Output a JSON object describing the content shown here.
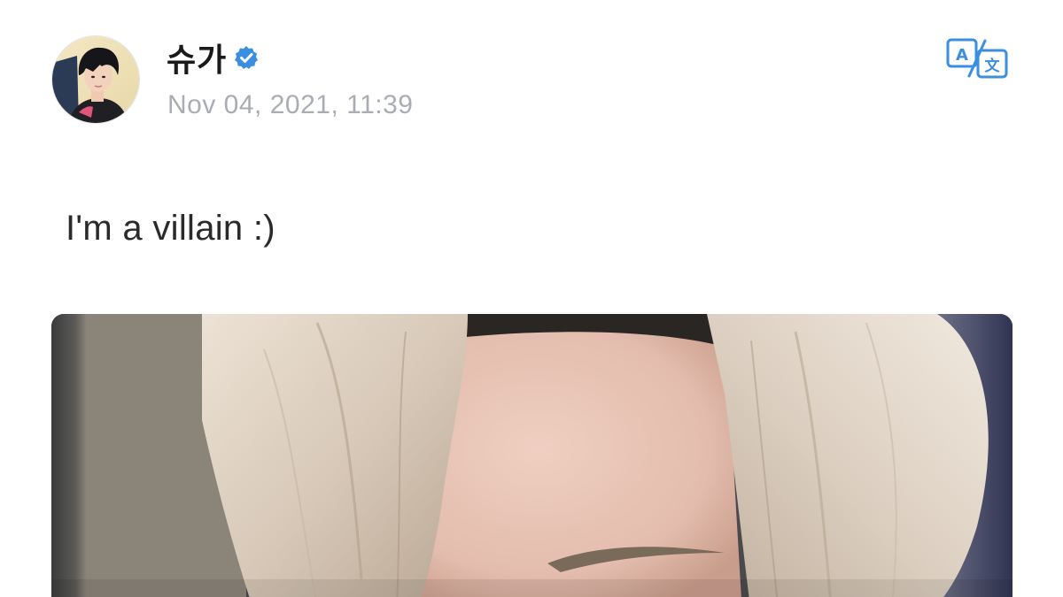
{
  "post": {
    "author": {
      "name": "슈가",
      "verified": true,
      "avatar_icon": "profile-photo"
    },
    "timestamp": "Nov 04, 2021, 11:39",
    "text": "I'm a villain :)",
    "translate": {
      "icon": "translate-icon",
      "glyph_latin": "A",
      "glyph_cjk": "文"
    },
    "image": {
      "description_icon": "photo-attachment"
    }
  },
  "colors": {
    "verified_blue": "#1d9bf0",
    "timestamp_gray": "#a9adb3",
    "accent_blue": "#3b8fe0",
    "text": "#2a2a2a"
  }
}
